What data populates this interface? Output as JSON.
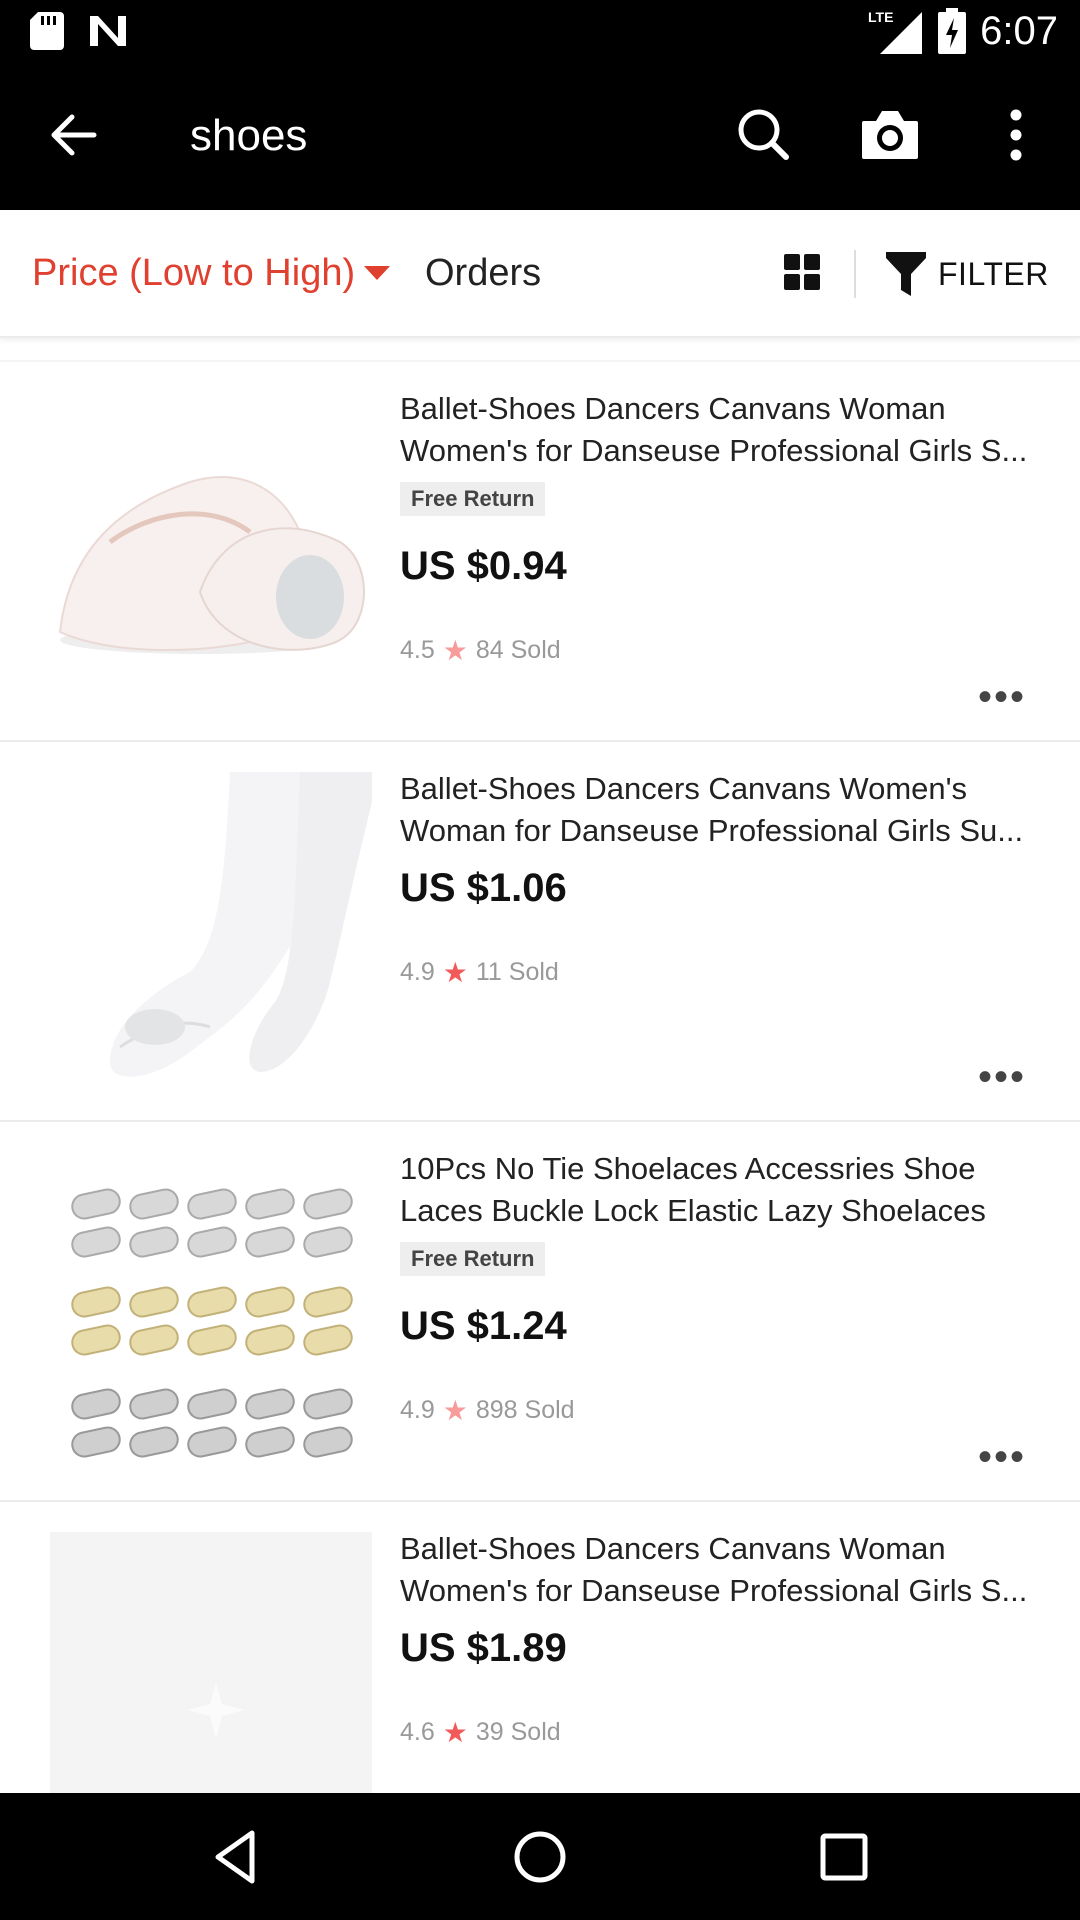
{
  "status_bar": {
    "time": "6:07",
    "network": "LTE",
    "icons": [
      "sd-card-icon",
      "notification-n-icon",
      "signal-icon",
      "battery-charging-icon"
    ]
  },
  "app_bar": {
    "title": "shoes",
    "icons": [
      "back-arrow-icon",
      "search-icon",
      "camera-icon",
      "more-vert-icon"
    ]
  },
  "sort_bar": {
    "price_label": "Price (Low to High)",
    "orders_label": "Orders",
    "filter_label": "FILTER",
    "accent_color": "#e0402f"
  },
  "products": [
    {
      "title_line1": "Ballet-Shoes Dancers Canvans Woman",
      "title_line2": "Women's for Danseuse Professional Girls S...",
      "badge": "Free Return",
      "price": "US $0.94",
      "rating": "4.5",
      "sold": "84 Sold"
    },
    {
      "title_line1": "Ballet-Shoes Dancers Canvans Women's",
      "title_line2": "Woman for Danseuse Professional Girls Su...",
      "badge": "",
      "price": "US $1.06",
      "rating": "4.9",
      "sold": "11 Sold"
    },
    {
      "title_line1": "10Pcs No Tie Shoelaces Accessries Shoe",
      "title_line2": "Laces Buckle Lock Elastic Lazy Shoelaces",
      "badge": "Free Return",
      "price": "US $1.24",
      "rating": "4.9",
      "sold": "898 Sold"
    },
    {
      "title_line1": "Ballet-Shoes Dancers Canvans Woman",
      "title_line2": "Women's for Danseuse Professional Girls S...",
      "badge": "",
      "price": "US $1.89",
      "rating": "4.6",
      "sold": "39 Sold"
    }
  ],
  "nav_bar": {
    "icons": [
      "back-triangle-icon",
      "home-circle-icon",
      "recents-square-icon"
    ]
  }
}
